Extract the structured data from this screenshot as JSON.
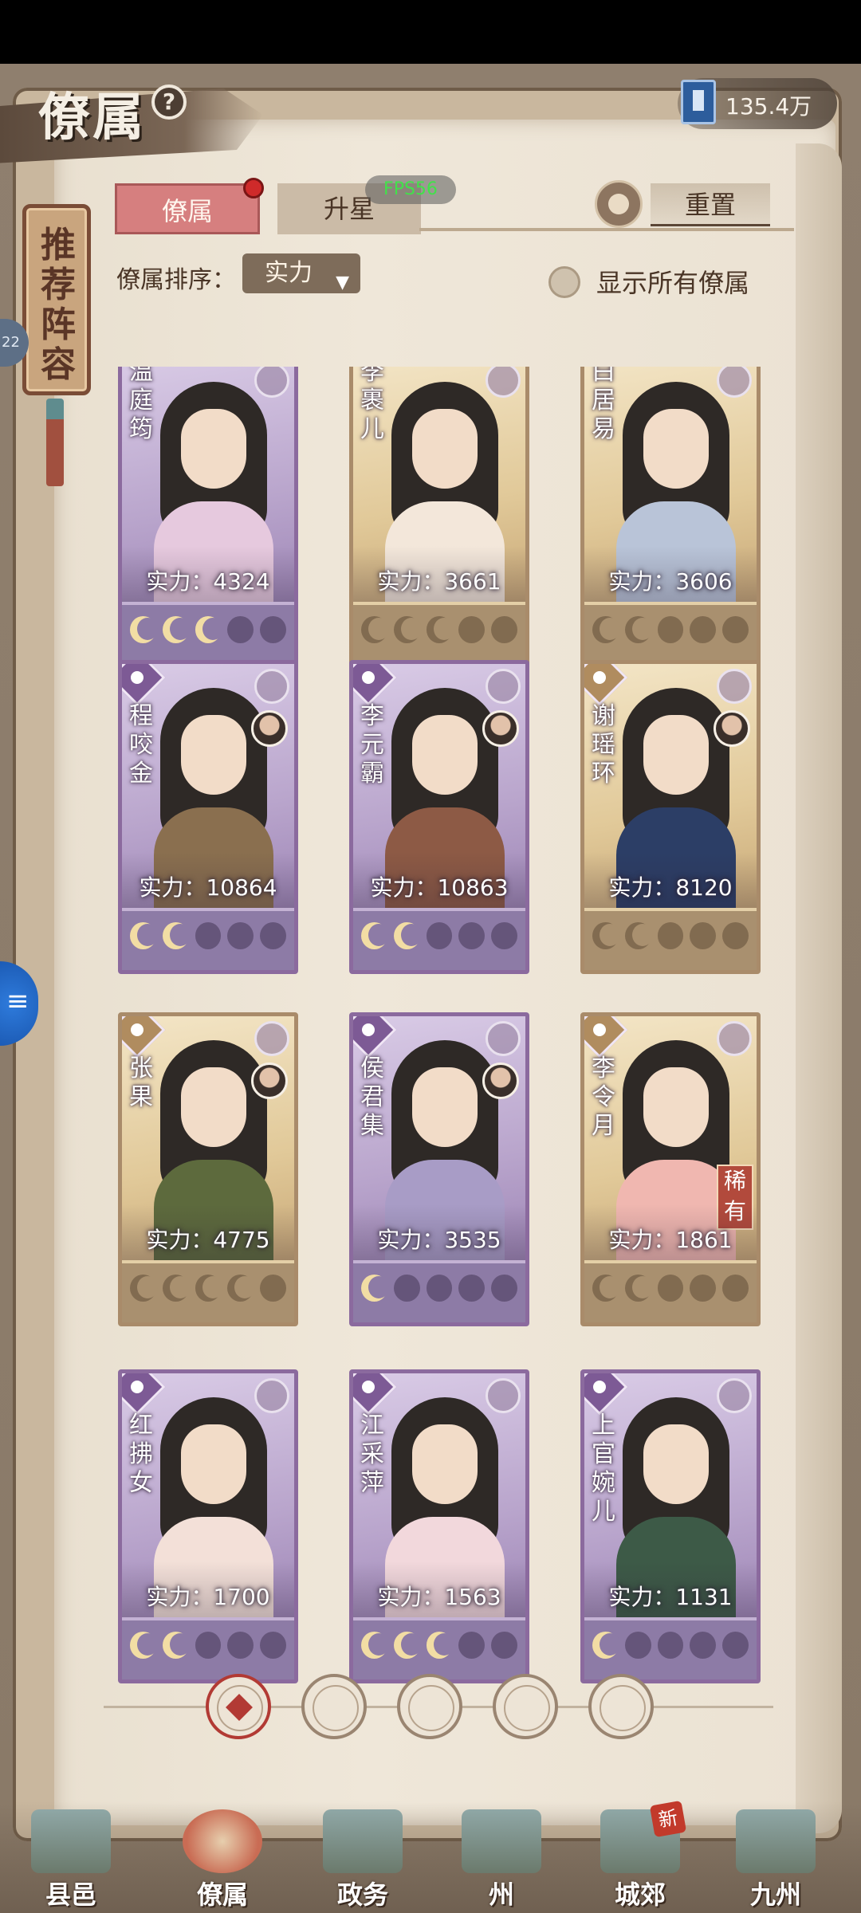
{
  "header": {
    "title": "僚属",
    "help": "?",
    "currency_value": "135.4万"
  },
  "recommend": {
    "label": "推荐阵容"
  },
  "side_badge": "22",
  "tabs": {
    "subordinates": "僚属",
    "starup": "升星"
  },
  "fps": "FPS56",
  "reset_label": "重置",
  "sort": {
    "label": "僚属排序：",
    "selected": "实力"
  },
  "show_all_label": "显示所有僚属",
  "cards": [
    {
      "name": "温庭筠",
      "power": "实力：4324",
      "tier": "purple",
      "stars": 3,
      "avatar": false,
      "rare": false
    },
    {
      "name": "李裹儿",
      "power": "实力：3661",
      "tier": "gold",
      "stars": 3,
      "avatar": false,
      "rare": false
    },
    {
      "name": "白居易",
      "power": "实力：3606",
      "tier": "gold",
      "stars": 2,
      "avatar": false,
      "rare": false
    },
    {
      "name": "程咬金",
      "power": "实力：10864",
      "tier": "purple",
      "stars": 2,
      "avatar": true,
      "rare": false
    },
    {
      "name": "李元霸",
      "power": "实力：10863",
      "tier": "purple",
      "stars": 2,
      "avatar": true,
      "rare": false
    },
    {
      "name": "谢瑶环",
      "power": "实力：8120",
      "tier": "gold",
      "stars": 2,
      "avatar": true,
      "rare": false
    },
    {
      "name": "张果",
      "power": "实力：4775",
      "tier": "gold",
      "stars": 4,
      "avatar": true,
      "rare": false
    },
    {
      "name": "侯君集",
      "power": "实力：3535",
      "tier": "purple",
      "stars": 1,
      "avatar": true,
      "rare": false
    },
    {
      "name": "李令月",
      "power": "实力：1861",
      "tier": "gold",
      "stars": 2,
      "avatar": false,
      "rare": true
    },
    {
      "name": "红拂女",
      "power": "实力：1700",
      "tier": "purple",
      "stars": 2,
      "avatar": false,
      "rare": false
    },
    {
      "name": "江采萍",
      "power": "实力：1563",
      "tier": "purple",
      "stars": 3,
      "avatar": false,
      "rare": false
    },
    {
      "name": "上官婉儿",
      "power": "实力：1131",
      "tier": "purple",
      "stars": 1,
      "avatar": false,
      "rare": false
    }
  ],
  "rare_label": "稀有",
  "filters": [
    "all",
    "type-1",
    "type-2",
    "type-3",
    "type-4"
  ],
  "nav": [
    {
      "label": "县邑",
      "active": false,
      "badge": ""
    },
    {
      "label": "僚属",
      "active": true,
      "badge": ""
    },
    {
      "label": "政务",
      "active": false,
      "badge": ""
    },
    {
      "label": "州",
      "active": false,
      "badge": ""
    },
    {
      "label": "城郊",
      "active": false,
      "badge": "新"
    },
    {
      "label": "九州",
      "active": false,
      "badge": ""
    }
  ],
  "colors": {
    "accent": "#d67f7f",
    "purple_frame": "#8b6a9e",
    "gold_frame": "#a98b6a",
    "page": "#efe7d9"
  }
}
